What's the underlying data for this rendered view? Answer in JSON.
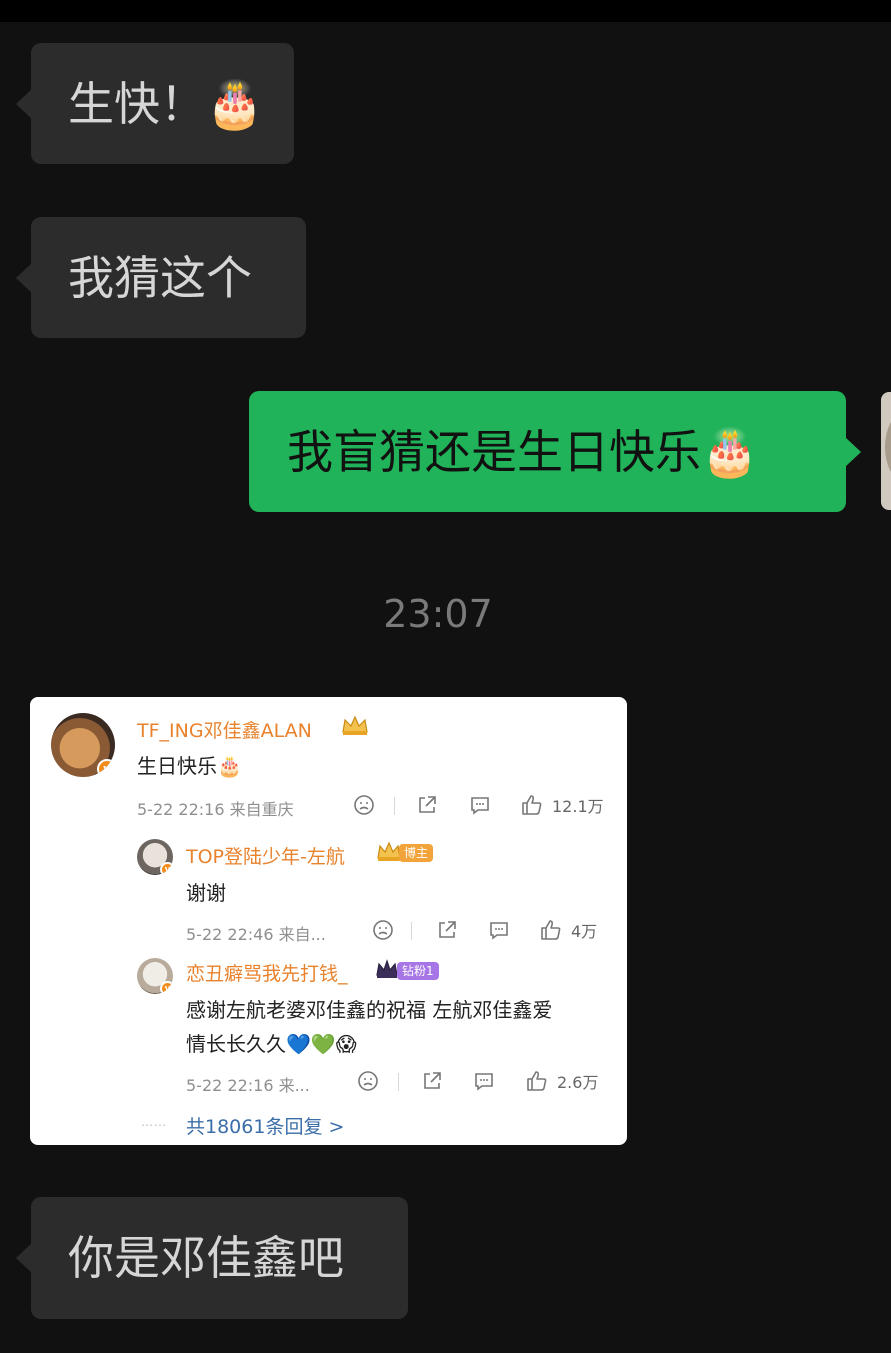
{
  "messages": [
    {
      "text": "生快！🎂"
    },
    {
      "text": "我猜这个"
    },
    {
      "text": "我盲猜还是生日快乐🎂"
    },
    {
      "text": "你是邓佳鑫吧"
    }
  ],
  "timestamp": "23:07",
  "weibo": {
    "comment": {
      "user": "TF_ING邓佳鑫ALAN",
      "text": "生日快乐🎂",
      "meta": "5-22 22:16  来自重庆",
      "likes": "12.1万"
    },
    "replies": [
      {
        "user": "TOP登陆少年-左航",
        "tag": "博主",
        "text": "谢谢",
        "meta": "5-22 22:46  来自...",
        "likes": "4万"
      },
      {
        "user": "恋丑癖骂我先打钱_",
        "tag": "钻粉1",
        "text_line1": "感谢左航老婆邓佳鑫的祝福 左航邓佳鑫爱",
        "text_line2": "情长长久久💙💚😱",
        "meta": "5-22 22:16  来...",
        "likes": "2.6万"
      }
    ],
    "more": "共18061条回复 >",
    "dots": "……"
  },
  "colors": {
    "background": "#111111",
    "incoming_bubble": "#2c2c2c",
    "outgoing_bubble": "#21b359",
    "weibo_username": "#e8822c",
    "weibo_link": "#3b6ea8"
  }
}
